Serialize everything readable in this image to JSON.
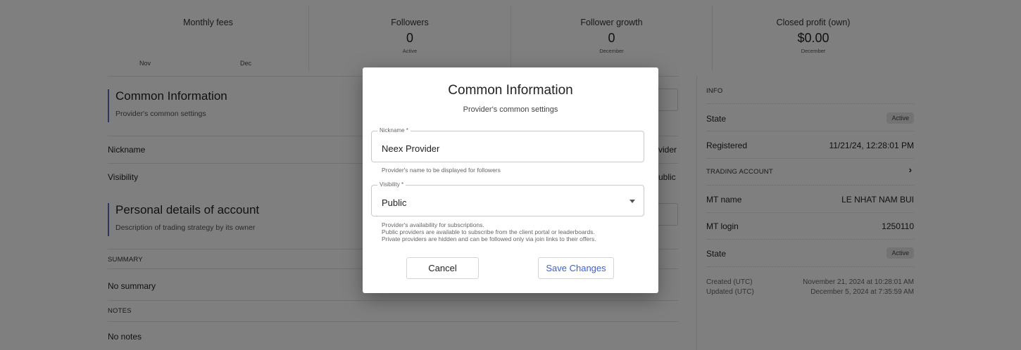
{
  "stats": {
    "monthly_fees": {
      "title": "Monthly fees",
      "months": [
        "Nov",
        "Dec"
      ]
    },
    "followers": {
      "title": "Followers",
      "value": "0",
      "sub": "Active"
    },
    "follower_growth": {
      "title": "Follower growth",
      "value": "0",
      "sub": "December"
    },
    "closed_profit": {
      "title": "Closed profit (own)",
      "value": "$0.00",
      "sub": "December"
    }
  },
  "left": {
    "common": {
      "title": "Common Information",
      "subtitle": "Provider's common settings"
    },
    "rows": {
      "nickname_label": "Nickname",
      "nickname_value_partial": "vider",
      "visibility_label": "Visibility",
      "visibility_value_partial": "ublic"
    },
    "personal": {
      "title": "Personal details of account",
      "subtitle": "Description of trading strategy by its owner"
    },
    "summary": {
      "label": "SUMMARY",
      "value": "No summary"
    },
    "notes": {
      "label": "NOTES",
      "value": "No notes"
    }
  },
  "right": {
    "info_header": "INFO",
    "state_label": "State",
    "state_badge": "Active",
    "registered_label": "Registered",
    "registered_value": "11/21/24, 12:28:01 PM",
    "trading_account_header": "TRADING ACCOUNT",
    "chevron": "›",
    "mt_name_label": "MT name",
    "mt_name_value": "LE NHAT NAM BUI",
    "mt_login_label": "MT login",
    "mt_login_value": "1250110",
    "mt_state_label": "State",
    "mt_state_badge": "Active",
    "created_label": "Created (UTC)",
    "created_value": "November 21, 2024 at 10:28:01 AM",
    "updated_label": "Updated (UTC)",
    "updated_value": "December 5, 2024 at 7:35:59 AM"
  },
  "modal": {
    "title": "Common Information",
    "subtitle": "Provider's common settings",
    "nickname": {
      "label": "Nickname *",
      "value": "Neex Provider",
      "helper": "Provider's name to be displayed for followers"
    },
    "visibility": {
      "label": "Visibility *",
      "value": "Public",
      "helper_lines": [
        "Provider's availability for subscriptions.",
        "Public providers are available to subscribe from the client portal or leaderboards.",
        "Private providers are hidden and can be followed only via join links to their offers."
      ]
    },
    "cancel_label": "Cancel",
    "save_label": "Save Changes"
  },
  "colors": {
    "accent": "#5c6bc0",
    "save_text": "#3b5fd9",
    "overlay": "#000000"
  }
}
